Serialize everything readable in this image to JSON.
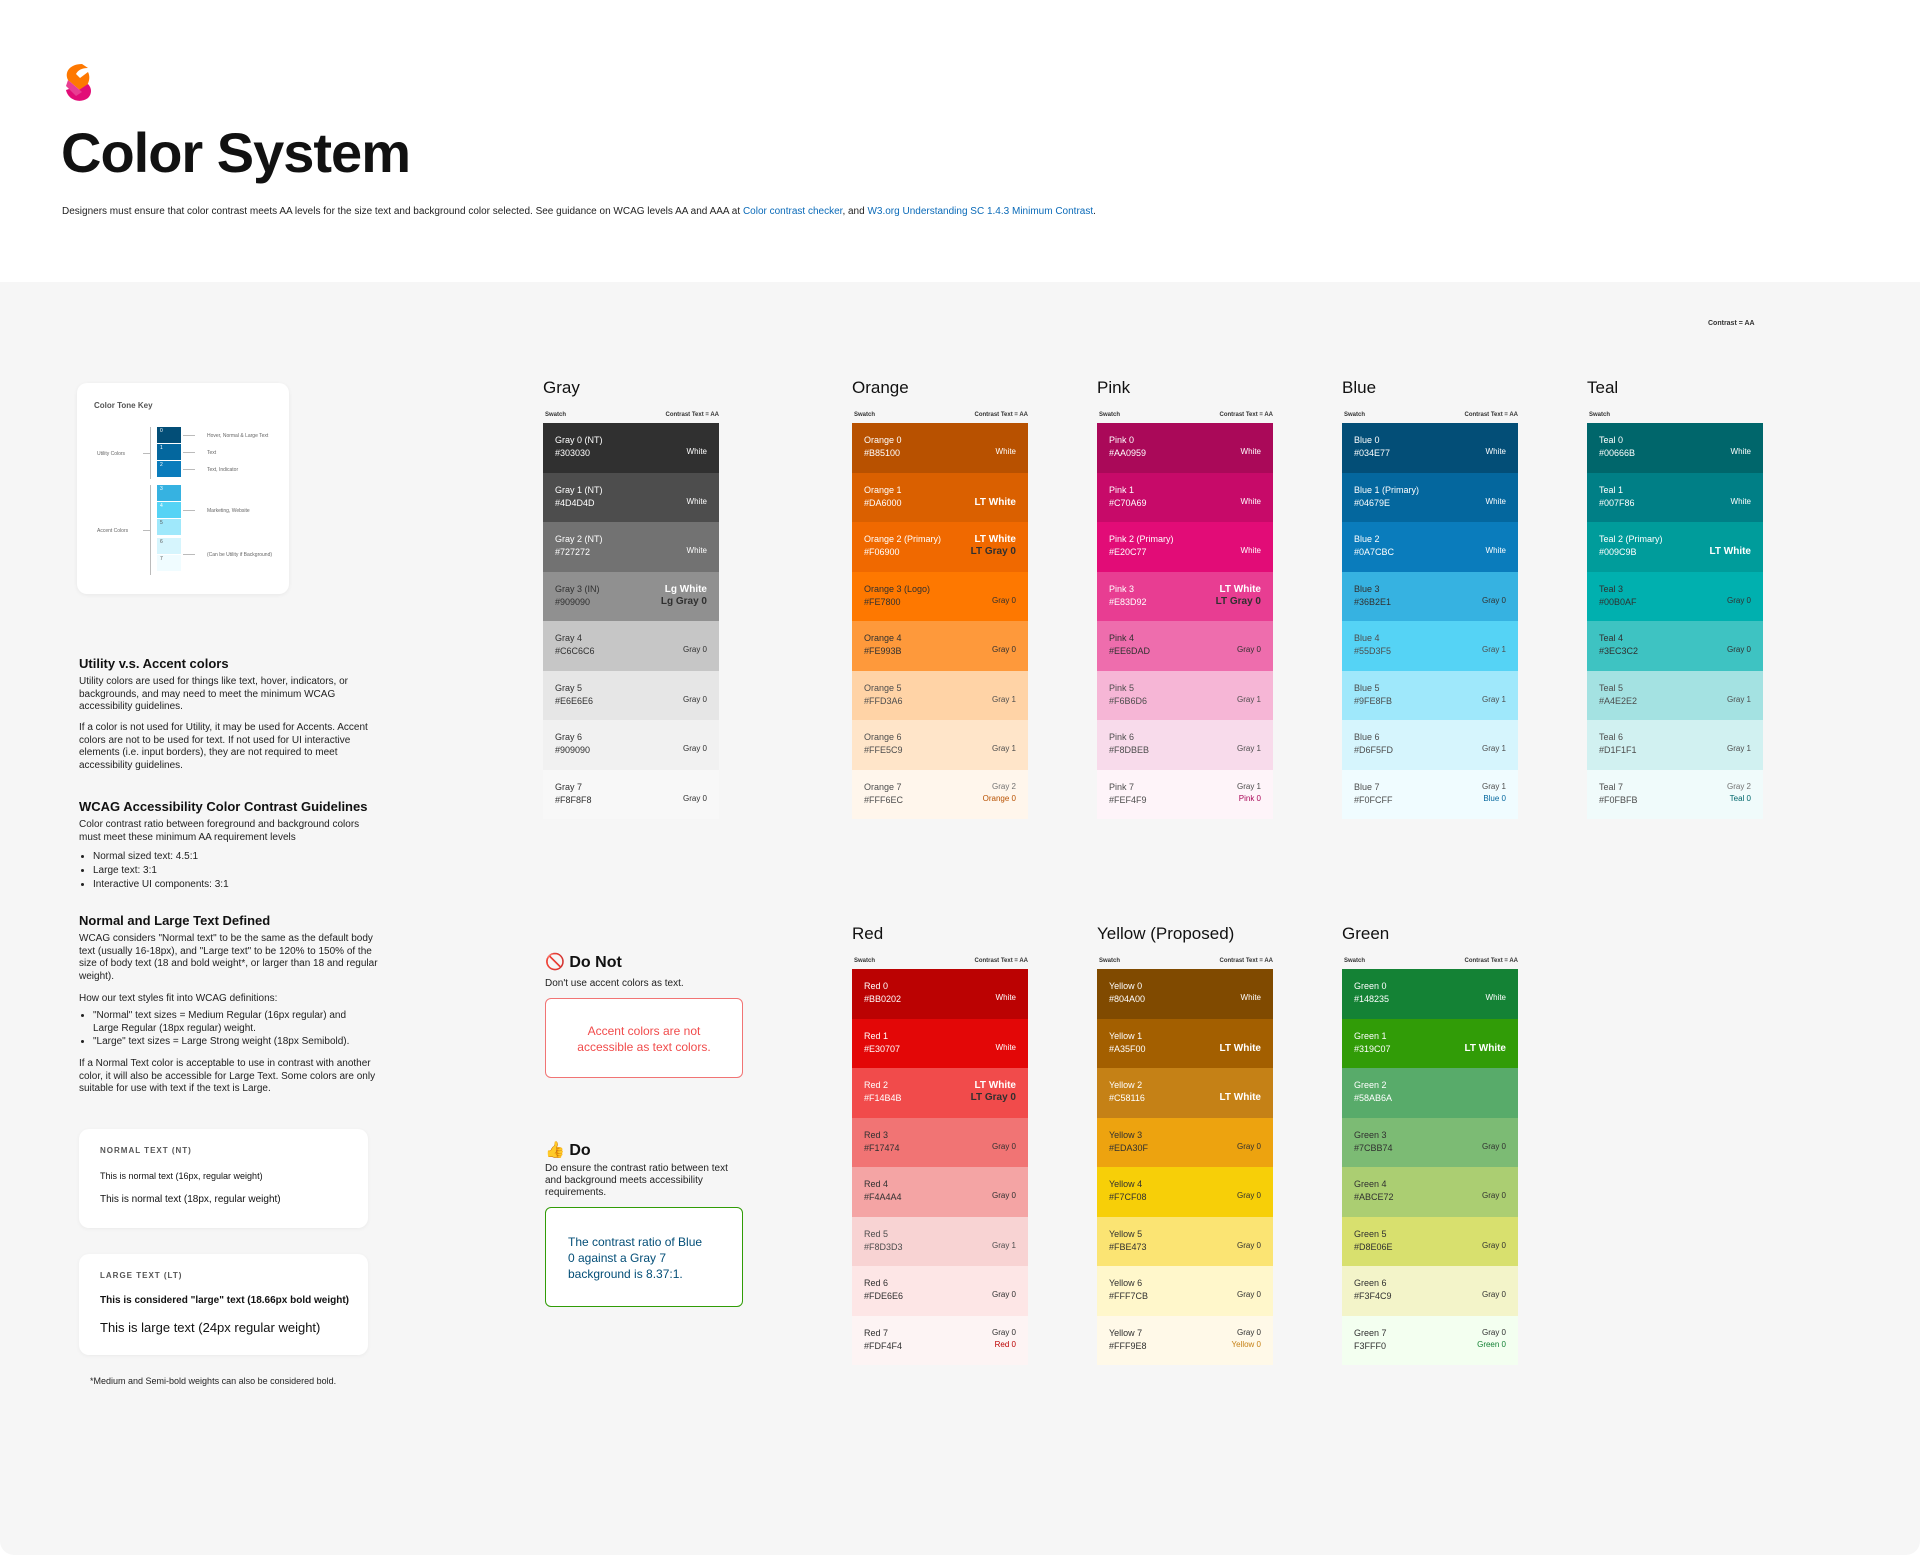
{
  "header": {
    "title": "Color System",
    "intro_text": "Designers must ensure that color contrast meets AA levels for the size text and background color selected. See guidance on WCAG levels AA and AAA at ",
    "link1": "Color contrast checker",
    "intro_mid": ", and ",
    "link2": "W3.org Understanding SC 1.4.3 Minimum Contrast",
    "intro_end": "."
  },
  "contrast_note": "Contrast = AA",
  "tone_key": {
    "title": "Color Tone Key",
    "utility_label": "Utility Colors",
    "accent_label": "Accent Colors",
    "notes": [
      "Hover, Normal & Large Text",
      "Text",
      "Text, Indicator",
      "Marketing, Website",
      "(Can be Utility if Background)"
    ],
    "steps": [
      "0",
      "1",
      "2",
      "3",
      "4",
      "5",
      "6",
      "7"
    ]
  },
  "guide": {
    "h1": "Utility v.s. Accent colors",
    "p1": "Utility colors are used for things like text, hover, indicators, or backgrounds, and may need to meet the minimum WCAG accessibility guidelines.",
    "p2": "If a color is not used for Utility, it may be used for Accents. Accent colors are not to be used for text. If not used for UI interactive elements (i.e. input borders), they are not required to meet accessibility guidelines.",
    "h2": "WCAG Accessibility Color Contrast Guidelines",
    "p3": "Color contrast ratio between foreground and background colors must meet these minimum AA requirement levels",
    "bullets1": [
      "Normal sized text: 4.5:1",
      "Large text: 3:1",
      "Interactive UI components: 3:1"
    ],
    "h3": "Normal and Large Text Defined",
    "p4": "WCAG considers \"Normal text\" to be the same as the default body text (usually 16-18px), and \"Large text\" to be 120% to 150% of the size of body text (18 and bold weight*, or larger than 18 and regular weight).",
    "p5": "How our text styles fit into WCAG definitions:",
    "bullets2": [
      "\"Normal\" text sizes = Medium Regular (16px regular) and Large Regular (18px regular) weight.",
      "\"Large\" text sizes = Large Strong weight (18px Semibold)."
    ],
    "p6": "If a Normal Text color is acceptable to use in contrast with another color, it will also be accessible for Large Text. Some colors are only suitable for use with text if the text is Large."
  },
  "normal_card": {
    "label": "NORMAL TEXT (NT)",
    "line1": "This is normal text (16px, regular weight)",
    "line2": "This is normal text (18px, regular weight)"
  },
  "large_card": {
    "label": "LARGE TEXT (LT)",
    "line1": "This is considered \"large\" text (18.66px bold weight)",
    "line2": "This is large text (24px regular weight)"
  },
  "footnote": "*Medium and Semi-bold weights can also be considered bold.",
  "dont": {
    "icon": "🚫",
    "title": "Do Not",
    "desc": "Don't use accent colors as text.",
    "example": "Accent colors are not accessible as text colors.",
    "color": "#F14B4B"
  },
  "do": {
    "icon": "👍",
    "title": "Do",
    "desc": "Do ensure the contrast ratio between text and background meets accessibility requirements.",
    "example": "The contrast ratio of Blue 0 against a Gray 7 background is 8.37:1.",
    "color": "#034E77",
    "border": "#319C07"
  },
  "swatch_header": "Swatch",
  "contrast_header": "Contrast Text = AA",
  "palettes": [
    {
      "key": "gray",
      "name": "Gray",
      "show_contrast_header": true,
      "swatches": [
        {
          "name": "Gray 0 (NT)",
          "hex": "#303030",
          "labels": [
            "White"
          ],
          "lc": [
            "#ffffff"
          ],
          "tc": "#ffffff"
        },
        {
          "name": "Gray 1 (NT)",
          "hex": "#4D4D4D",
          "labels": [
            "White"
          ],
          "lc": [
            "#ffffff"
          ],
          "tc": "#ffffff"
        },
        {
          "name": "Gray 2 (NT)",
          "hex": "#727272",
          "labels": [
            "White"
          ],
          "lc": [
            "#ffffff"
          ],
          "tc": "#ffffff"
        },
        {
          "name": "Gray 3 (IN)",
          "hex": "#909090",
          "labels": [
            "Lg White",
            "Lg Gray 0"
          ],
          "lc": [
            "#ffffff",
            "#303030"
          ],
          "tc": "#303030",
          "big": true
        },
        {
          "name": "Gray 4",
          "hex": "#C6C6C6",
          "labels": [
            "Gray 0"
          ],
          "lc": [
            "#303030"
          ],
          "tc": "#303030"
        },
        {
          "name": "Gray 5",
          "hex": "#E6E6E6",
          "labels": [
            "Gray 0"
          ],
          "lc": [
            "#303030"
          ],
          "tc": "#303030"
        },
        {
          "name": "Gray 6",
          "hex": "#909090",
          "bg": "#F1F1F1",
          "labels": [
            "Gray 0"
          ],
          "lc": [
            "#303030"
          ],
          "tc": "#303030"
        },
        {
          "name": "Gray 7",
          "hex": "#F8F8F8",
          "labels": [
            "Gray 0"
          ],
          "lc": [
            "#303030"
          ],
          "tc": "#303030"
        }
      ]
    },
    {
      "key": "orange",
      "name": "Orange",
      "show_contrast_header": true,
      "swatches": [
        {
          "name": "Orange 0",
          "hex": "#B85100",
          "labels": [
            "White"
          ],
          "lc": [
            "#ffffff"
          ],
          "tc": "#ffffff"
        },
        {
          "name": "Orange 1",
          "hex": "#DA6000",
          "labels": [
            "LT White"
          ],
          "lc": [
            "#ffffff"
          ],
          "tc": "#ffffff",
          "big": true
        },
        {
          "name": "Orange 2 (Primary)",
          "hex": "#F06900",
          "labels": [
            "LT White",
            "LT Gray 0"
          ],
          "lc": [
            "#ffffff",
            "#303030"
          ],
          "tc": "#ffffff",
          "big": true
        },
        {
          "name": "Orange 3 (Logo)",
          "hex": "#FE7800",
          "labels": [
            "Gray 0"
          ],
          "lc": [
            "#303030"
          ],
          "tc": "#303030"
        },
        {
          "name": "Orange 4",
          "hex": "#FE993B",
          "labels": [
            "Gray 0"
          ],
          "lc": [
            "#303030"
          ],
          "tc": "#303030"
        },
        {
          "name": "Orange 5",
          "hex": "#FFD3A6",
          "labels": [
            "Gray 1"
          ],
          "lc": [
            "#4D4D4D"
          ],
          "tc": "#4D4D4D"
        },
        {
          "name": "Orange 6",
          "hex": "#FFE5C9",
          "labels": [
            "Gray 1"
          ],
          "lc": [
            "#4D4D4D"
          ],
          "tc": "#4D4D4D"
        },
        {
          "name": "Orange 7",
          "hex": "#FFF6EC",
          "labels": [
            "Gray 2",
            "Orange 0"
          ],
          "lc": [
            "#727272",
            "#B85100"
          ],
          "tc": "#4D4D4D"
        }
      ]
    },
    {
      "key": "pink",
      "name": "Pink",
      "show_contrast_header": true,
      "swatches": [
        {
          "name": "Pink 0",
          "hex": "#AA0959",
          "labels": [
            "White"
          ],
          "lc": [
            "#ffffff"
          ],
          "tc": "#ffffff"
        },
        {
          "name": "Pink 1",
          "hex": "#C70A69",
          "labels": [
            "White"
          ],
          "lc": [
            "#ffffff"
          ],
          "tc": "#ffffff"
        },
        {
          "name": "Pink 2 (Primary)",
          "hex": "#E20C77",
          "labels": [
            "White"
          ],
          "lc": [
            "#ffffff"
          ],
          "tc": "#ffffff"
        },
        {
          "name": "Pink 3",
          "hex": "#E83D92",
          "labels": [
            "LT White",
            "LT Gray 0"
          ],
          "lc": [
            "#ffffff",
            "#303030"
          ],
          "tc": "#ffffff",
          "big": true
        },
        {
          "name": "Pink 4",
          "hex": "#EE6DAD",
          "labels": [
            "Gray 0"
          ],
          "lc": [
            "#303030"
          ],
          "tc": "#303030"
        },
        {
          "name": "Pink 5",
          "hex": "#F6B6D6",
          "labels": [
            "Gray 1"
          ],
          "lc": [
            "#4D4D4D"
          ],
          "tc": "#4D4D4D"
        },
        {
          "name": "Pink 6",
          "hex": "#F8DBEB",
          "labels": [
            "Gray 1"
          ],
          "lc": [
            "#4D4D4D"
          ],
          "tc": "#4D4D4D"
        },
        {
          "name": "Pink 7",
          "hex": "#FEF4F9",
          "labels": [
            "Gray 1",
            "Pink 0"
          ],
          "lc": [
            "#4D4D4D",
            "#AA0959"
          ],
          "tc": "#4D4D4D"
        }
      ]
    },
    {
      "key": "blue",
      "name": "Blue",
      "show_contrast_header": true,
      "swatches": [
        {
          "name": "Blue 0",
          "hex": "#034E77",
          "labels": [
            "White"
          ],
          "lc": [
            "#ffffff"
          ],
          "tc": "#ffffff"
        },
        {
          "name": "Blue 1 (Primary)",
          "hex": "#04679E",
          "labels": [
            "White"
          ],
          "lc": [
            "#ffffff"
          ],
          "tc": "#ffffff"
        },
        {
          "name": "Blue 2",
          "hex": "#0A7CBC",
          "labels": [
            "White"
          ],
          "lc": [
            "#ffffff"
          ],
          "tc": "#ffffff"
        },
        {
          "name": "Blue 3",
          "hex": "#36B2E1",
          "labels": [
            "Gray 0"
          ],
          "lc": [
            "#303030"
          ],
          "tc": "#303030"
        },
        {
          "name": "Blue 4",
          "hex": "#55D3F5",
          "labels": [
            "Gray 1"
          ],
          "lc": [
            "#4D4D4D"
          ],
          "tc": "#4D4D4D"
        },
        {
          "name": "Blue 5",
          "hex": "#9FE8FB",
          "labels": [
            "Gray 1"
          ],
          "lc": [
            "#4D4D4D"
          ],
          "tc": "#4D4D4D"
        },
        {
          "name": "Blue 6",
          "hex": "#D6F5FD",
          "labels": [
            "Gray 1"
          ],
          "lc": [
            "#4D4D4D"
          ],
          "tc": "#4D4D4D"
        },
        {
          "name": "Blue 7",
          "hex": "#F0FCFF",
          "labels": [
            "Gray 1",
            "Blue 0"
          ],
          "lc": [
            "#4D4D4D",
            "#04679E"
          ],
          "tc": "#4D4D4D"
        }
      ]
    },
    {
      "key": "teal",
      "name": "Teal",
      "show_contrast_header": false,
      "swatches": [
        {
          "name": "Teal 0",
          "hex": "#00666B",
          "labels": [
            "White"
          ],
          "lc": [
            "#ffffff"
          ],
          "tc": "#ffffff"
        },
        {
          "name": "Teal 1",
          "hex": "#007F86",
          "labels": [
            "White"
          ],
          "lc": [
            "#ffffff"
          ],
          "tc": "#ffffff"
        },
        {
          "name": "Teal 2 (Primary)",
          "hex": "#009C9B",
          "labels": [
            "LT White"
          ],
          "lc": [
            "#ffffff"
          ],
          "tc": "#ffffff",
          "big": true
        },
        {
          "name": "Teal 3",
          "hex": "#00B0AF",
          "labels": [
            "Gray 0"
          ],
          "lc": [
            "#303030"
          ],
          "tc": "#303030"
        },
        {
          "name": "Teal 4",
          "hex": "#3EC3C2",
          "labels": [
            "Gray 0"
          ],
          "lc": [
            "#303030"
          ],
          "tc": "#303030"
        },
        {
          "name": "Teal 5",
          "hex": "#A4E2E2",
          "labels": [
            "Gray 1"
          ],
          "lc": [
            "#4D4D4D"
          ],
          "tc": "#4D4D4D"
        },
        {
          "name": "Teal 6",
          "hex": "#D1F1F1",
          "labels": [
            "Gray 1"
          ],
          "lc": [
            "#4D4D4D"
          ],
          "tc": "#4D4D4D"
        },
        {
          "name": "Teal 7",
          "hex": "#F0FBFB",
          "labels": [
            "Gray 2",
            "Teal 0"
          ],
          "lc": [
            "#727272",
            "#00666B"
          ],
          "tc": "#4D4D4D"
        }
      ]
    },
    {
      "key": "red",
      "name": "Red",
      "show_contrast_header": true,
      "swatches": [
        {
          "name": "Red 0",
          "hex": "#BB0202",
          "labels": [
            "White"
          ],
          "lc": [
            "#ffffff"
          ],
          "tc": "#ffffff"
        },
        {
          "name": "Red 1",
          "hex": "#E30707",
          "labels": [
            "White"
          ],
          "lc": [
            "#ffffff"
          ],
          "tc": "#ffffff"
        },
        {
          "name": "Red 2",
          "hex": "#F14B4B",
          "labels": [
            "LT White",
            "LT Gray 0"
          ],
          "lc": [
            "#ffffff",
            "#303030"
          ],
          "tc": "#ffffff",
          "big": true
        },
        {
          "name": "Red 3",
          "hex": "#F17474",
          "labels": [
            "Gray 0"
          ],
          "lc": [
            "#303030"
          ],
          "tc": "#303030"
        },
        {
          "name": "Red 4",
          "hex": "#F4A4A4",
          "labels": [
            "Gray 0"
          ],
          "lc": [
            "#303030"
          ],
          "tc": "#303030"
        },
        {
          "name": "Red 5",
          "hex": "#F8D3D3",
          "labels": [
            "Gray 1"
          ],
          "lc": [
            "#4D4D4D"
          ],
          "tc": "#4D4D4D"
        },
        {
          "name": "Red 6",
          "hex": "#FDE6E6",
          "labels": [
            "Gray 0"
          ],
          "lc": [
            "#303030"
          ],
          "tc": "#303030"
        },
        {
          "name": "Red 7",
          "hex": "#FDF4F4",
          "labels": [
            "Gray 0",
            "Red 0"
          ],
          "lc": [
            "#303030",
            "#BB0202"
          ],
          "tc": "#303030"
        }
      ]
    },
    {
      "key": "yellow",
      "name": "Yellow (Proposed)",
      "show_contrast_header": true,
      "swatches": [
        {
          "name": "Yellow 0",
          "hex": "#804A00",
          "labels": [
            "White"
          ],
          "lc": [
            "#ffffff"
          ],
          "tc": "#ffffff"
        },
        {
          "name": "Yellow 1",
          "hex": "#A35F00",
          "labels": [
            "LT White"
          ],
          "lc": [
            "#ffffff"
          ],
          "tc": "#ffffff",
          "big": true
        },
        {
          "name": "Yellow 2",
          "hex": "#C58116",
          "labels": [
            "LT White"
          ],
          "lc": [
            "#ffffff"
          ],
          "tc": "#ffffff",
          "big": true
        },
        {
          "name": "Yellow 3",
          "hex": "#EDA30F",
          "labels": [
            "Gray 0"
          ],
          "lc": [
            "#303030"
          ],
          "tc": "#303030"
        },
        {
          "name": "Yellow 4",
          "hex": "#F7CF08",
          "labels": [
            "Gray 0"
          ],
          "lc": [
            "#303030"
          ],
          "tc": "#303030"
        },
        {
          "name": "Yellow 5",
          "hex": "#FBE473",
          "labels": [
            "Gray 0"
          ],
          "lc": [
            "#303030"
          ],
          "tc": "#303030"
        },
        {
          "name": "Yellow 6",
          "hex": "#FFF7CB",
          "labels": [
            "Gray 0"
          ],
          "lc": [
            "#303030"
          ],
          "tc": "#303030"
        },
        {
          "name": "Yellow 7",
          "hex": "#FFF9E8",
          "labels": [
            "Gray 0",
            "Yellow 0"
          ],
          "lc": [
            "#303030",
            "#C58116"
          ],
          "tc": "#303030"
        }
      ]
    },
    {
      "key": "green",
      "name": "Green",
      "show_contrast_header": true,
      "swatches": [
        {
          "name": "Green 0",
          "hex": "#148235",
          "labels": [
            "White"
          ],
          "lc": [
            "#ffffff"
          ],
          "tc": "#ffffff"
        },
        {
          "name": "Green 1",
          "hex": "#319C07",
          "labels": [
            "LT White"
          ],
          "lc": [
            "#ffffff"
          ],
          "tc": "#ffffff",
          "big": true
        },
        {
          "name": "Green 2",
          "hex": "#58AB6A",
          "labels": [],
          "lc": [],
          "tc": "#ffffff"
        },
        {
          "name": "Green 3",
          "hex": "#7CBB74",
          "labels": [
            "Gray 0"
          ],
          "lc": [
            "#303030"
          ],
          "tc": "#303030"
        },
        {
          "name": "Green 4",
          "hex": "#ABCE72",
          "labels": [
            "Gray 0"
          ],
          "lc": [
            "#303030"
          ],
          "tc": "#303030"
        },
        {
          "name": "Green 5",
          "hex": "#D8E06E",
          "labels": [
            "Gray 0"
          ],
          "lc": [
            "#303030"
          ],
          "tc": "#303030"
        },
        {
          "name": "Green 6",
          "hex": "#F3F4C9",
          "labels": [
            "Gray 0"
          ],
          "lc": [
            "#303030"
          ],
          "tc": "#303030"
        },
        {
          "name": "Green 7",
          "hex": "F3FFF0",
          "bg": "#F3FFF0",
          "labels": [
            "Gray 0",
            "Green 0"
          ],
          "lc": [
            "#303030",
            "#148235"
          ],
          "tc": "#303030"
        }
      ]
    }
  ]
}
